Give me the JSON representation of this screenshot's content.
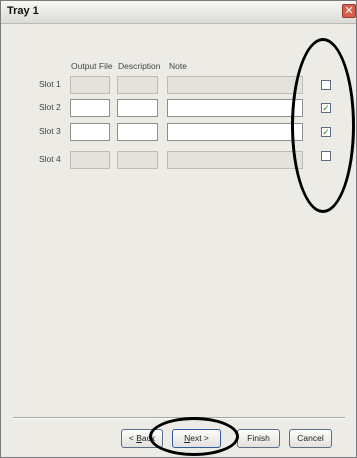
{
  "window": {
    "title": "Tray 1",
    "close_glyph": "✕"
  },
  "columns": {
    "output_file": "Output File",
    "description": "Description",
    "note": "Note"
  },
  "slots": [
    {
      "label": "Slot 1",
      "enabled": false,
      "checked": false
    },
    {
      "label": "Slot 2",
      "enabled": true,
      "checked": true
    },
    {
      "label": "Slot 3",
      "enabled": true,
      "checked": true
    },
    {
      "label": "Slot 4",
      "enabled": false,
      "checked": false
    }
  ],
  "buttons": {
    "back": {
      "label_prefix": "< ",
      "mnemonic": "B",
      "label_rest": "ack"
    },
    "next": {
      "mnemonic": "N",
      "label_rest": "ext >"
    },
    "finish": "Finish",
    "cancel": "Cancel"
  },
  "check_glyph": "✓"
}
